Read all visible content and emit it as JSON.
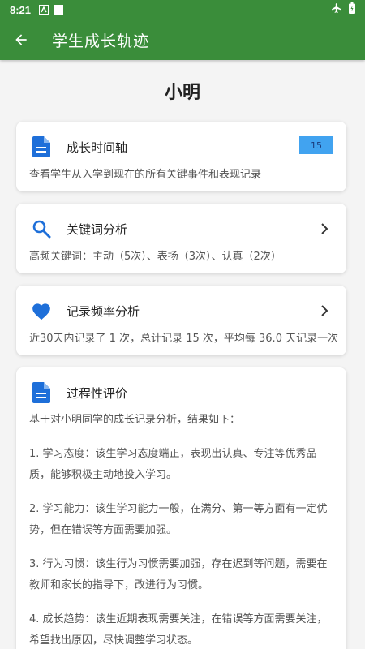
{
  "status": {
    "time": "8:21"
  },
  "header": {
    "title": "学生成长轨迹"
  },
  "student": {
    "name": "小明"
  },
  "cards": {
    "timeline": {
      "title": "成长时间轴",
      "badge": "15",
      "desc": "查看学生从入学到现在的所有关键事件和表现记录"
    },
    "keywords": {
      "title": "关键词分析",
      "desc": "高频关键词：主动（5次）、表扬（3次）、认真（2次）"
    },
    "frequency": {
      "title": "记录频率分析",
      "desc": "近30天内记录了 1 次，总计记录 15 次，平均每 36.0 天记录一次"
    },
    "evaluation": {
      "title": "过程性评价",
      "intro": "基于对小明同学的成长记录分析，结果如下：",
      "items": [
        "1. 学习态度：该生学习态度端正，表现出认真、专注等优秀品质，能够积极主动地投入学习。",
        "2. 学习能力：该生学习能力一般，在满分、第一等方面有一定优势，但在错误等方面需要加强。",
        "3. 行为习惯：该生行为习惯需要加强，存在迟到等问题，需要在教师和家长的指导下，改进行为习惯。",
        "4. 成长趋势：该生近期表现需要关注，在错误等方面需要关注，希望找出原因，尽快调整学习状态。"
      ]
    }
  },
  "colors": {
    "appbar": "#3a8d3a",
    "icon_blue": "#1e6fd9",
    "badge": "#41a3f0"
  },
  "icons": {
    "back": "arrow-back-icon",
    "doc": "document-icon",
    "search": "search-icon",
    "heart": "heart-icon",
    "chevron": "chevron-right-icon"
  }
}
